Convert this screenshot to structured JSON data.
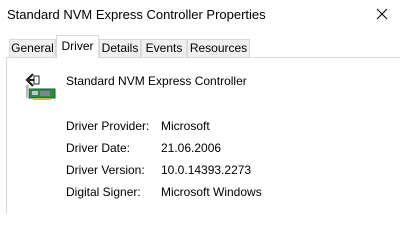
{
  "window": {
    "title": "Standard NVM Express Controller Properties"
  },
  "tabs": [
    {
      "label": "General",
      "active": false
    },
    {
      "label": "Driver",
      "active": true
    },
    {
      "label": "Details",
      "active": false
    },
    {
      "label": "Events",
      "active": false
    },
    {
      "label": "Resources",
      "active": false
    }
  ],
  "device": {
    "name": "Standard NVM Express Controller",
    "icon": "controller-card-icon"
  },
  "driver_info": [
    {
      "label": "Driver Provider:",
      "value": "Microsoft"
    },
    {
      "label": "Driver Date:",
      "value": "21.06.2006"
    },
    {
      "label": "Driver Version:",
      "value": "10.0.14393.2273"
    },
    {
      "label": "Digital Signer:",
      "value": "Microsoft Windows"
    }
  ],
  "colors": {
    "tab_border": "#d9d9d9",
    "inactive_tab_bg": "#f0f0f0"
  }
}
